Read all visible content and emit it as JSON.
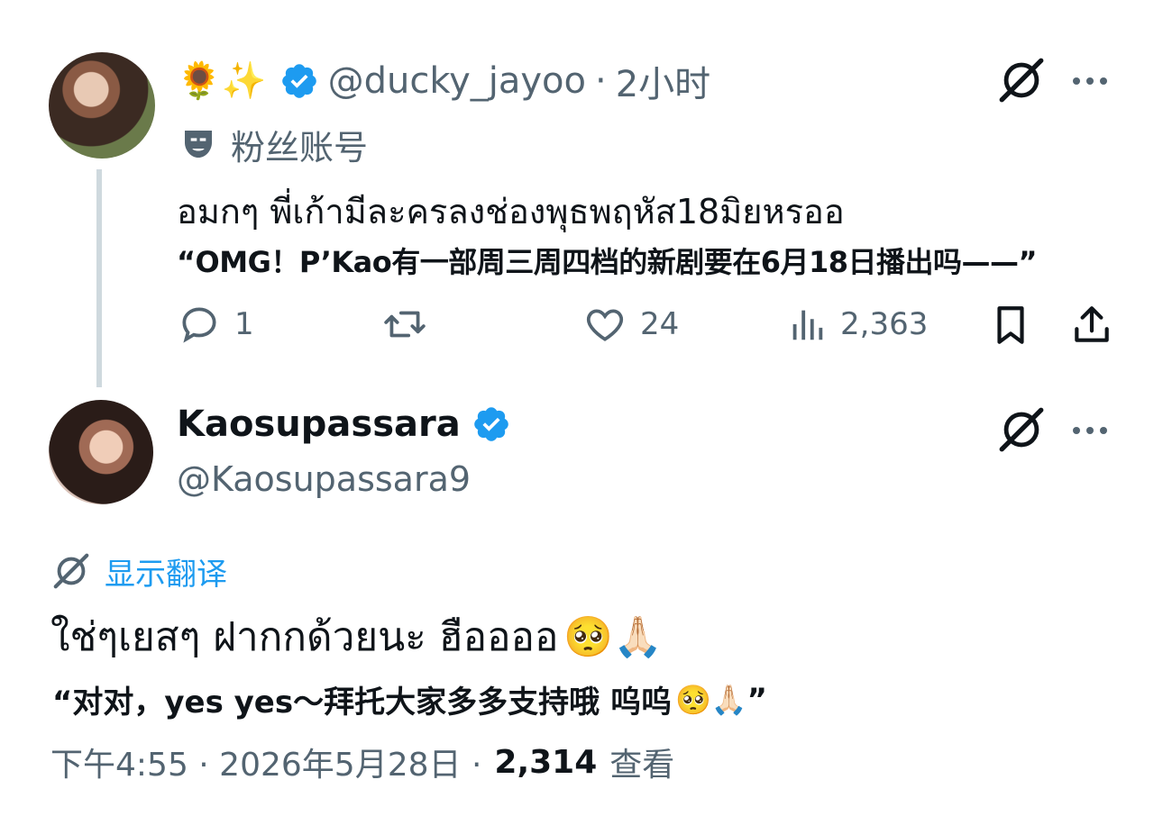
{
  "tweet1": {
    "emojis": "🌻✨",
    "handle": "@ducky_jayoo",
    "time_sep": "·",
    "time": "2小时",
    "fan_label": "粉丝账号",
    "text_thai": "อมกๆ พี่เก้ามีละครลงช่องพุธพฤหัส18มิยหรออ",
    "text_translation": "“OMG！P’Kao有一部周三周四档的新剧要在6月18日播出吗——”",
    "actions": {
      "replies": "1",
      "retweets": "",
      "likes": "24",
      "views": "2,363"
    }
  },
  "tweet2": {
    "name": "Kaosupassara",
    "handle": "@Kaosupassara9",
    "show_translation": "显示翻译",
    "text_thai": "ใช่ๆเยสๆ ฝากกด้วยนะ ฮืออออ",
    "text_thai_emojis": "🥺🙏🏻",
    "text_translation": "“对对，yes yes～拜托大家多多支持哦 呜呜",
    "text_translation_emojis": "🥺🙏🏻",
    "text_translation_close": "”",
    "timestamp": "下午4:55 · 2026年5月28日 ·",
    "view_count": "2,314",
    "view_label": "查看"
  },
  "colors": {
    "verified": "#1d9bf0",
    "link": "#1d9bf0",
    "secondary": "#536471",
    "primary": "#0f1419"
  }
}
